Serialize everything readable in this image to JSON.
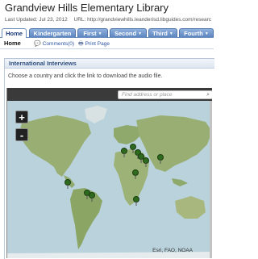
{
  "header": {
    "title": "Grandview Hills Elementary Library",
    "last_updated": "Last Updated: Jul 23, 2012",
    "url": "URL: http://grandviewhills.leanderisd.libguides.com/researc"
  },
  "tabs": [
    {
      "label": "Home",
      "active": true
    },
    {
      "label": "Kindergarten"
    },
    {
      "label": "First"
    },
    {
      "label": "Second"
    },
    {
      "label": "Third"
    },
    {
      "label": "Fourth"
    }
  ],
  "subnav": {
    "home": "Home",
    "comments": "Comments(0)",
    "print": "Print Page"
  },
  "panel": {
    "title": "International Interviews",
    "instructions": "Choose a country and click the link to download the audio file."
  },
  "map": {
    "search_placeholder": "Find address or place",
    "zoom_in": "+",
    "zoom_out": "-",
    "attribution": "Esri, FAO, NOAA",
    "ocean_color": "#b9d2db",
    "land_color": "#8fa86b",
    "pin_color": "#2f6b1e",
    "pins": [
      "Europe pin 1",
      "Europe pin 2",
      "Europe pin 3",
      "Europe pin 4",
      "Europe pin 5",
      "Asia pin",
      "Central America pin",
      "South America pin 1",
      "South America pin 2",
      "Africa pin",
      "Southern Africa pin"
    ]
  }
}
